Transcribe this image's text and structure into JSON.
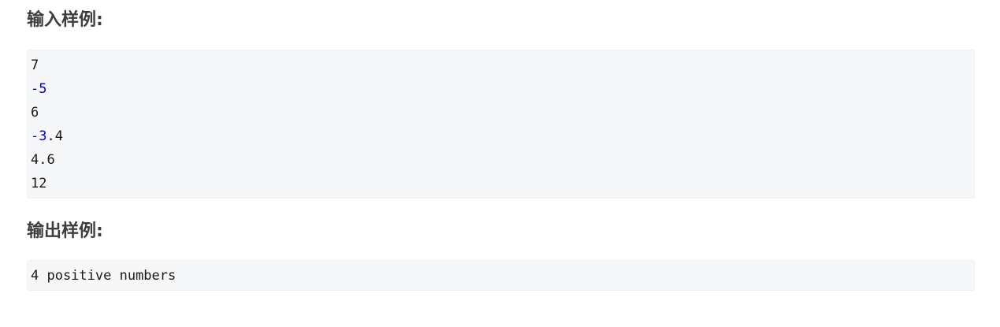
{
  "input_section": {
    "title": "输入样例:",
    "lines": [
      {
        "parts": [
          {
            "text": "7",
            "neg": false
          }
        ]
      },
      {
        "parts": [
          {
            "text": "-5",
            "neg": true
          }
        ]
      },
      {
        "parts": [
          {
            "text": "6",
            "neg": false
          }
        ]
      },
      {
        "parts": [
          {
            "text": "-3",
            "neg": true
          },
          {
            "text": ".4",
            "neg": false
          }
        ]
      },
      {
        "parts": [
          {
            "text": "4.6",
            "neg": false
          }
        ]
      },
      {
        "parts": [
          {
            "text": "12",
            "neg": false
          }
        ]
      }
    ]
  },
  "output_section": {
    "title": "输出样例:",
    "lines": [
      {
        "parts": [
          {
            "text": "4 positive numbers",
            "neg": false
          }
        ]
      }
    ]
  },
  "colors": {
    "negative_number": "#0000cc",
    "code_background": "#f6f7f9",
    "heading_text": "#3d3d3d"
  }
}
